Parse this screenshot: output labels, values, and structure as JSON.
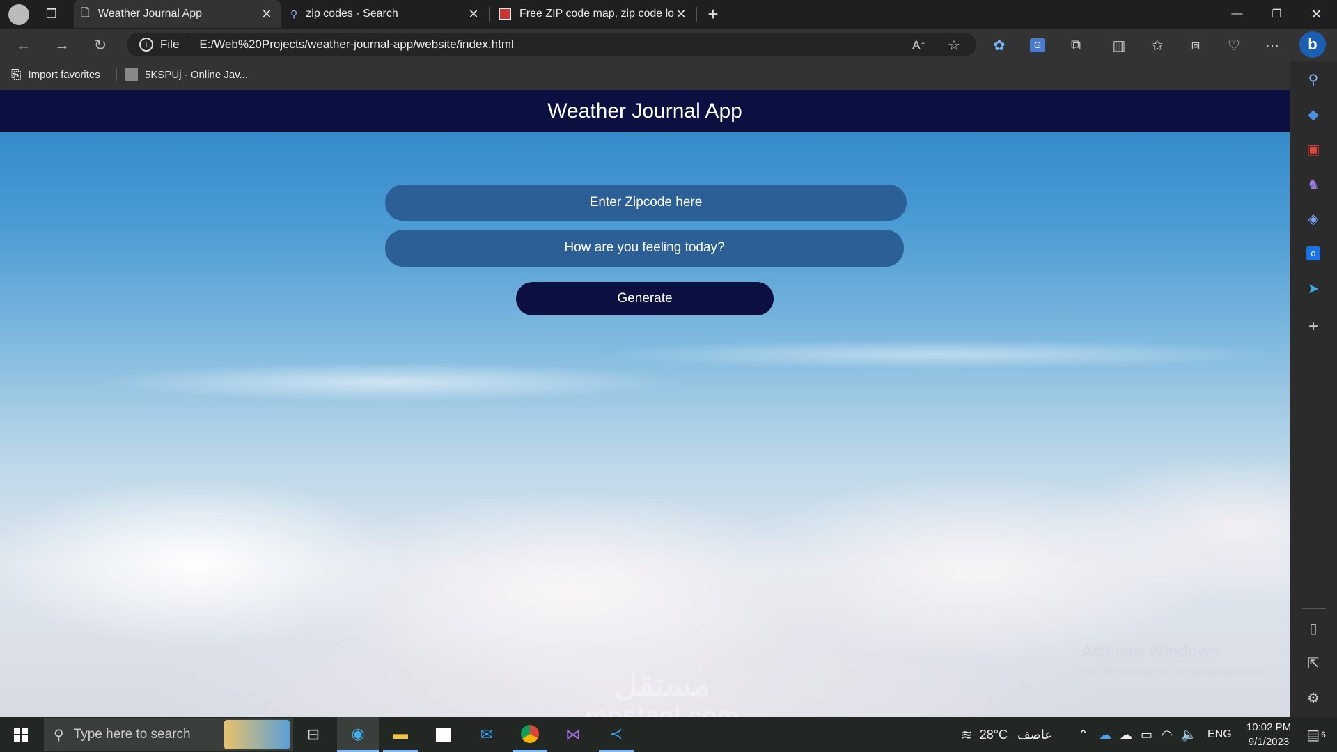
{
  "browser": {
    "tabs": [
      {
        "title": "Weather Journal App",
        "icon": "page-icon",
        "active": true
      },
      {
        "title": "zip codes - Search",
        "icon": "search-icon",
        "active": false
      },
      {
        "title": "Free ZIP code map, zip code look",
        "icon": "site-favicon",
        "active": false
      }
    ],
    "new_tab": "+",
    "address": {
      "scheme_label": "File",
      "url": "E:/Web%20Projects/weather-journal-app/website/index.html"
    },
    "favorites": [
      {
        "label": "Import favorites",
        "icon": "import-icon"
      },
      {
        "label": "5KSPUj - Online Jav...",
        "icon": "site-favicon"
      }
    ]
  },
  "app": {
    "title": "Weather Journal App",
    "zip_placeholder": "Enter Zipcode here",
    "feelings_placeholder": "How are you feeling today?",
    "generate_label": "Generate"
  },
  "overlay": {
    "activate_title": "Activate Windows",
    "activate_sub": "Go to Settings to activate Windows.",
    "watermark_ar": "مستقل",
    "watermark_en": "mostaql.com"
  },
  "taskbar": {
    "search_placeholder": "Type here to search",
    "weather_temp": "28°C",
    "weather_desc": "عاصف",
    "language": "ENG",
    "time": "10:02 PM",
    "date": "9/1/2023",
    "notification_count": "6"
  },
  "colors": {
    "header_bg": "#0b1040",
    "input_bg": "#2b5f95",
    "button_bg": "#0b1040"
  }
}
